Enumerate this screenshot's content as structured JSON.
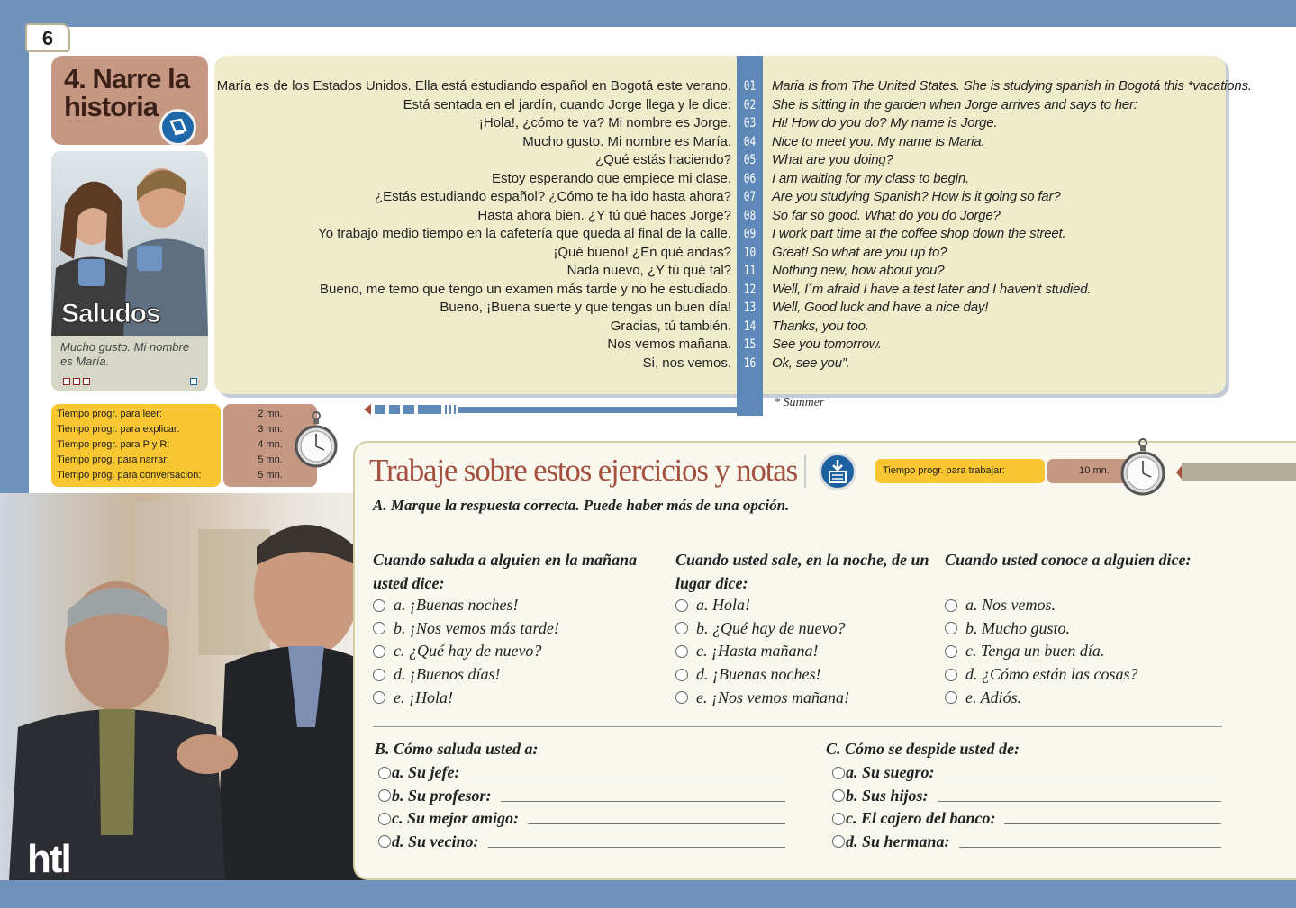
{
  "page": {
    "number": "6",
    "brand": "htl"
  },
  "lesson": {
    "title": "4. Narre la\nhistoria",
    "picture_title": "Saludos",
    "caption": "Mucho gusto. Mi nombre es María.",
    "icon": "book-pencil-icon"
  },
  "times": {
    "labels": [
      "Tiempo progr. para leer:",
      "Tiempo progr. para explicar:",
      "Tiempo progr. para P  y  R:",
      "Tiempo prog. para narrar:",
      "Tiempo prog. para conversacion:"
    ],
    "values": [
      "2 mn.",
      "3 mn.",
      "4 mn.",
      "5 mn.",
      "5 mn."
    ]
  },
  "dialogue": [
    {
      "n": "01",
      "es": "María es de los Estados Unidos. Ella está estudiando español en Bogotá este verano.",
      "en": "Maria is from The United States. She is studying spanish in Bogotá this *vacations."
    },
    {
      "n": "02",
      "es": "Está sentada en el jardín, cuando Jorge llega y le dice:",
      "en": "She is sitting in the garden when Jorge arrives and says to her:"
    },
    {
      "n": "03",
      "es": "¡Hola!, ¿cómo te va? Mi nombre es Jorge.",
      "en": "Hi! How do you do? My name is Jorge."
    },
    {
      "n": "04",
      "es": "Mucho gusto. Mi nombre es María.",
      "en": "Nice to meet you. My name is Maria."
    },
    {
      "n": "05",
      "es": "¿Qué estás haciendo?",
      "en": "What are you doing?"
    },
    {
      "n": "06",
      "es": "Estoy esperando que empiece mi clase.",
      "en": "I am waiting for my class to begin."
    },
    {
      "n": "07",
      "es": "¿Estás estudiando español? ¿Cómo te ha ido hasta ahora?",
      "en": "Are you studying Spanish? How is it going so far?"
    },
    {
      "n": "08",
      "es": "Hasta ahora bien. ¿Y tú qué haces Jorge?",
      "en": "So far so good. What do you do Jorge?"
    },
    {
      "n": "09",
      "es": "Yo trabajo medio tiempo en la cafetería que queda al final de la calle.",
      "en": "I work part time at the coffee shop down the street."
    },
    {
      "n": "10",
      "es": "¡Qué bueno! ¿En qué andas?",
      "en": "Great! So what are you up to?"
    },
    {
      "n": "11",
      "es": "Nada nuevo, ¿Y tú qué tal?",
      "en": "Nothing new, how about you?"
    },
    {
      "n": "12",
      "es": "Bueno, me temo que tengo un examen más tarde y no he estudiado.",
      "en": "Well, I´m afraid I have a test later and I haven't studied."
    },
    {
      "n": "13",
      "es": "Bueno, ¡Buena suerte y que tengas un buen día!",
      "en": "Well, Good luck and have a nice day!"
    },
    {
      "n": "14",
      "es": "Gracias, tú también.",
      "en": "Thanks, you too."
    },
    {
      "n": "15",
      "es": "Nos vemos mañana.",
      "en": "See you tomorrow."
    },
    {
      "n": "16",
      "es": "Si, nos vemos.",
      "en": "Ok, see you”."
    }
  ],
  "footnote": "* Summer",
  "exercises": {
    "title": "Trabaje sobre estos ejercicios y notas",
    "work_time_label": "Tiempo progr. para trabajar:",
    "work_time_value": "10 mn.",
    "instruction_a": "A. Marque la respuesta correcta. Puede haber más de una opción.",
    "questions": [
      {
        "head": "Cuando saluda a alguien en la mañana usted dice:",
        "options": [
          "a. ¡Buenas noches!",
          "b. ¡Nos vemos más tarde!",
          "c. ¿Qué hay de nuevo?",
          "d. ¡Buenos días!",
          "e. ¡Hola!"
        ]
      },
      {
        "head": "Cuando usted sale, en la noche, de un lugar dice:",
        "options": [
          "a. Hola!",
          "b. ¿Qué hay de nuevo?",
          "c. ¡Hasta mañana!",
          "d. ¡Buenas noches!",
          "e. ¡Nos vemos mañana!"
        ]
      },
      {
        "head": "Cuando usted conoce a alguien dice:",
        "options": [
          "a. Nos vemos.",
          "b. Mucho gusto.",
          "c. Tenga un buen día.",
          "d. ¿Cómo están las cosas?",
          "e. Adiós."
        ]
      }
    ],
    "section_b": {
      "head": "B. Cómo saluda usted a:",
      "items": [
        "a. Su jefe:",
        "b. Su profesor:",
        "c. Su mejor amigo:",
        "d. Su vecino:"
      ]
    },
    "section_c": {
      "head": "C. Cómo se despide usted de:",
      "items": [
        "a. Su suegro:",
        "b. Sus hijos:",
        "c. El cajero del banco:",
        "d. Su hermana:"
      ]
    }
  },
  "colors": {
    "frame": "#6f92ba",
    "title_box": "#c69883",
    "panel": "#eeeccb",
    "number_column": "#5d88b8",
    "time_box": "#f7c630",
    "exercise_title": "#a5503f"
  }
}
